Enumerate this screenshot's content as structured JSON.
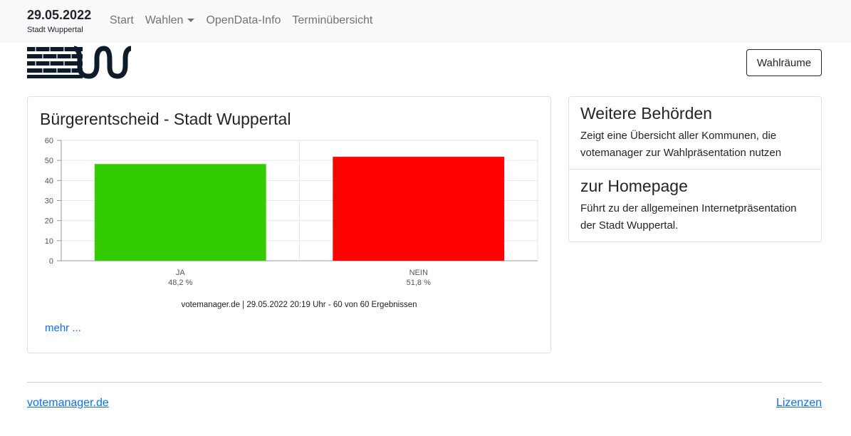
{
  "navbar": {
    "date": "29.05.2022",
    "city": "Stadt Wuppertal",
    "items": [
      {
        "label": "Start"
      },
      {
        "label": "Wahlen"
      },
      {
        "label": "OpenData-Info"
      },
      {
        "label": "Terminübersicht"
      }
    ]
  },
  "header": {
    "button_label": "Wahlräume"
  },
  "main": {
    "title": "Bürgerentscheid - Stadt Wuppertal",
    "more_link": "mehr ..."
  },
  "chart_data": {
    "type": "bar",
    "categories": [
      "JA",
      "NEIN"
    ],
    "values": [
      48.2,
      51.8
    ],
    "value_labels": [
      "48,2 %",
      "51,8 %"
    ],
    "colors": [
      "#33cc00",
      "#ff0000"
    ],
    "ylim": [
      0,
      60
    ],
    "yticks": [
      0,
      10,
      20,
      30,
      40,
      50,
      60
    ],
    "grid": true,
    "source": "votemanager.de | 29.05.2022 20:19 Uhr - 60 von 60 Ergebnissen"
  },
  "sidebar": {
    "items": [
      {
        "title": "Weitere Behörden",
        "text": "Zeigt eine Übersicht aller Kommunen, die votemanager zur Wahlpräsentation nutzen"
      },
      {
        "title": "zur Homepage",
        "text": "Führt zu der allgemeinen Internetpräsentation der Stadt Wuppertal."
      }
    ]
  },
  "footer": {
    "left_link": "votemanager.de",
    "right_link": "Lizenzen"
  }
}
